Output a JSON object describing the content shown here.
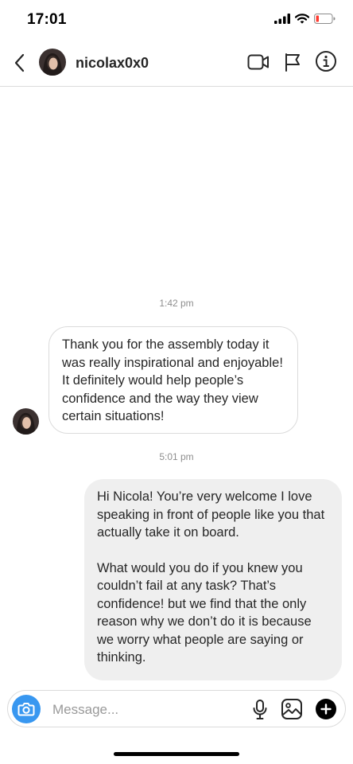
{
  "status_bar": {
    "time": "17:01"
  },
  "header": {
    "username": "nicolax0x0",
    "icons": [
      "back-chevron-icon",
      "video-call-icon",
      "flag-icon",
      "info-icon"
    ]
  },
  "thread": {
    "messages": [
      {
        "timestamp": "1:42 pm",
        "direction": "incoming",
        "text": "Thank you for the assembly today it was really inspirational and enjoyable! It definitely would help people’s confidence and the way they view certain situations!"
      },
      {
        "timestamp": "5:01 pm",
        "direction": "outgoing",
        "paragraphs": [
          "Hi Nicola! You’re very welcome I love speaking in front of people like you that actually take it on board.",
          "What would you do if you knew you couldn’t fail at any task? That’s confidence! but we find that the only reason why we don’t do it is because we worry what people are saying or thinking."
        ]
      }
    ]
  },
  "composer": {
    "placeholder": "Message...",
    "value": "",
    "icons": [
      "camera-icon",
      "microphone-icon",
      "gallery-icon",
      "add-icon"
    ]
  },
  "colors": {
    "accent": "#3897f0",
    "outgoing_bubble": "#efefef",
    "border": "#dbdbdb",
    "meta_text": "#8e8e8e",
    "battery_low": "#ff3b30"
  }
}
